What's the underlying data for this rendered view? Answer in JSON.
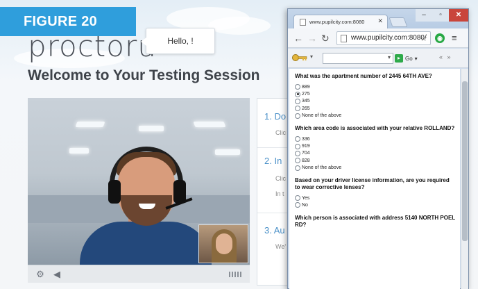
{
  "figure_label": "FIGURE 20",
  "proctor": {
    "logo": "proctoru",
    "hello": "Hello, !",
    "welcome": "Welcome to Your Testing Session",
    "steps": [
      {
        "title": "1. Do",
        "sub": "Clic"
      },
      {
        "title": "2. In",
        "sub": "Clic",
        "sub2": "In t"
      },
      {
        "title": "3. Au",
        "sub": "We'"
      }
    ]
  },
  "browser": {
    "tab_title": "www.pupilcity.com:8080",
    "url": "www.pupilcity.com:8080/",
    "go_label": "Go",
    "window_controls": {
      "minimize": "–",
      "maximize": "▫",
      "close": "✕"
    }
  },
  "quiz": {
    "questions": [
      {
        "text": "What was the apartment number of 2445 64TH AVE?",
        "options": [
          "889",
          "275",
          "345",
          "265",
          "None of the above"
        ],
        "selected": 1
      },
      {
        "text": "Which area code is associated with your relative ROLLAND?",
        "options": [
          "336",
          "919",
          "704",
          "828",
          "None of the above"
        ],
        "selected": -1
      },
      {
        "text": "Based on your driver license information, are you required to wear corrective lenses?",
        "options": [
          "Yes",
          "No"
        ],
        "selected": -1
      },
      {
        "text": "Which person is associated with address 5140 NORTH POEL RD?",
        "options": [],
        "selected": -1
      }
    ]
  },
  "colors": {
    "figure_label_bg": "#2f9edc",
    "step_blue": "#4a90c8",
    "close_red": "#c9453b"
  }
}
